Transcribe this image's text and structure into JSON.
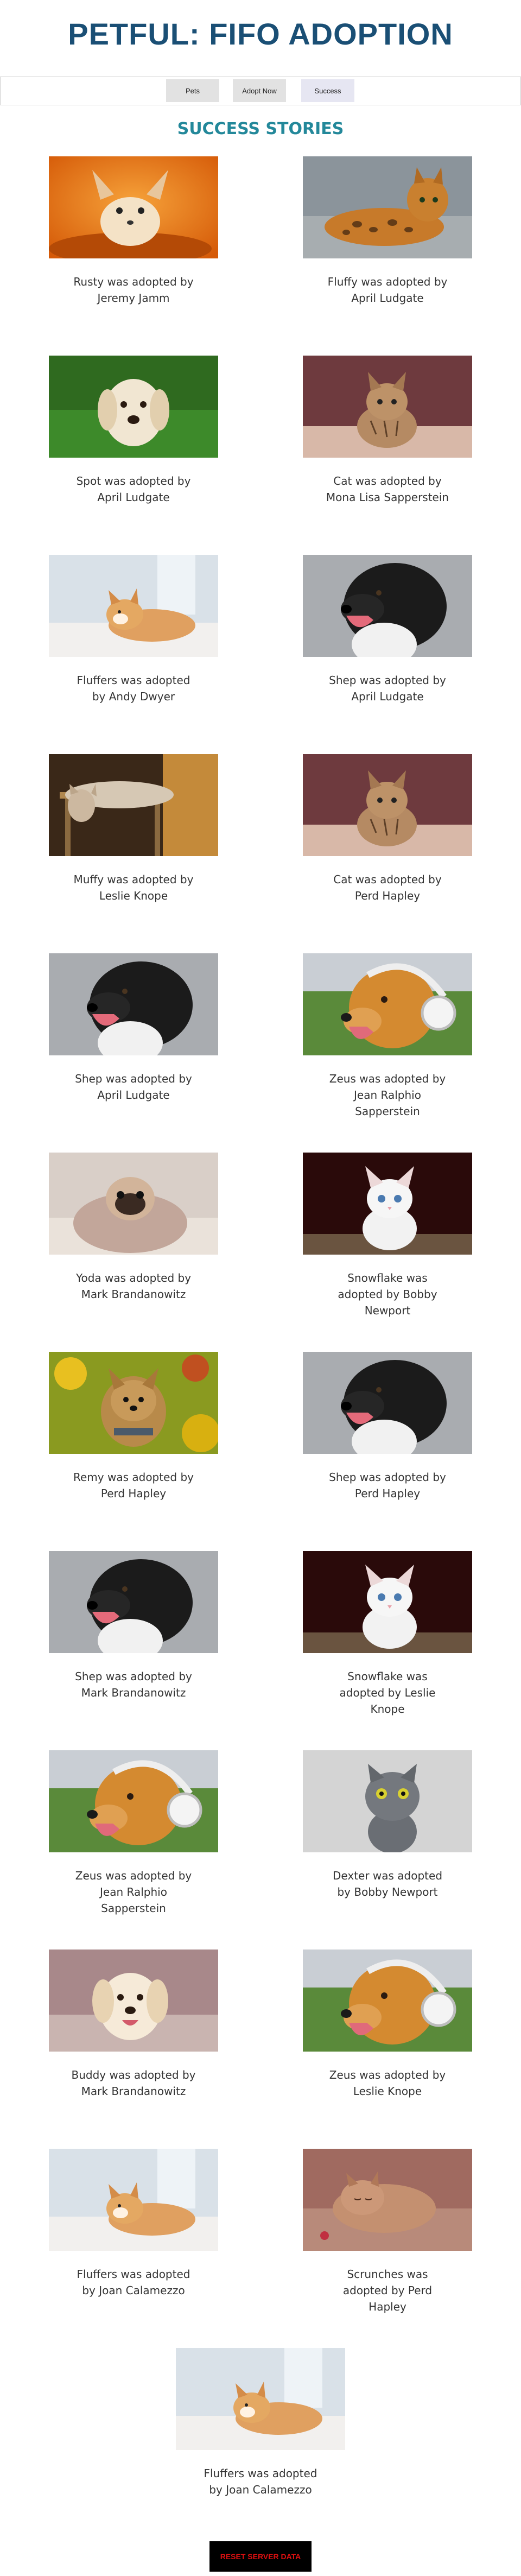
{
  "title": "PETFUL: FIFO ADOPTION",
  "nav": {
    "pets": "Pets",
    "adopt_now": "Adopt Now",
    "success": "Success"
  },
  "subtitle": "SUCCESS STORIES",
  "stories": [
    {
      "caption": "Rusty was adopted by Jeremy Jamm",
      "pet": "chihuahua"
    },
    {
      "caption": "Fluffy was adopted by April Ludgate",
      "pet": "bengal-cat"
    },
    {
      "caption": "Spot was adopted by April Ludgate",
      "pet": "golden-retriever"
    },
    {
      "caption": "Cat was adopted by Mona Lisa Sapperstein",
      "pet": "tabby-kitten"
    },
    {
      "caption": "Fluffers was adopted by Andy Dwyer",
      "pet": "shiba-puppy"
    },
    {
      "caption": "Shep was adopted by April Ludgate",
      "pet": "black-dog"
    },
    {
      "caption": "Muffy was adopted by Leslie Knope",
      "pet": "sleeping-cat"
    },
    {
      "caption": "Cat was adopted by Perd Hapley",
      "pet": "tabby-kitten"
    },
    {
      "caption": "Shep was adopted by April Ludgate",
      "pet": "black-dog"
    },
    {
      "caption": "Zeus was adopted by Jean Ralphio Sapperstein",
      "pet": "headphone-dog"
    },
    {
      "caption": "Yoda was adopted by Mark Brandanowitz",
      "pet": "pug"
    },
    {
      "caption": "Snowflake was adopted by Bobby Newport",
      "pet": "white-kitten"
    },
    {
      "caption": "Remy was adopted by Perd Hapley",
      "pet": "yorkie"
    },
    {
      "caption": "Shep was adopted by Perd Hapley",
      "pet": "black-dog"
    },
    {
      "caption": "Shep was adopted by Mark Brandanowitz",
      "pet": "black-dog"
    },
    {
      "caption": "Snowflake was adopted by Leslie Knope",
      "pet": "white-kitten"
    },
    {
      "caption": "Zeus was adopted by Jean Ralphio Sapperstein",
      "pet": "headphone-dog"
    },
    {
      "caption": "Dexter was adopted by Bobby Newport",
      "pet": "gray-cat"
    },
    {
      "caption": "Buddy was adopted by Mark Brandanowitz",
      "pet": "golden-retriever-2"
    },
    {
      "caption": "Zeus was adopted by Leslie Knope",
      "pet": "headphone-dog"
    },
    {
      "caption": "Fluffers was adopted by Joan Calamezzo",
      "pet": "shiba-puppy"
    },
    {
      "caption": "Scrunches was adopted by Perd Hapley",
      "pet": "sleeping-kitten"
    },
    {
      "caption": "Fluffers was adopted by Joan Calamezzo",
      "pet": "shiba-puppy"
    }
  ],
  "reset_button": "RESET SERVER DATA"
}
